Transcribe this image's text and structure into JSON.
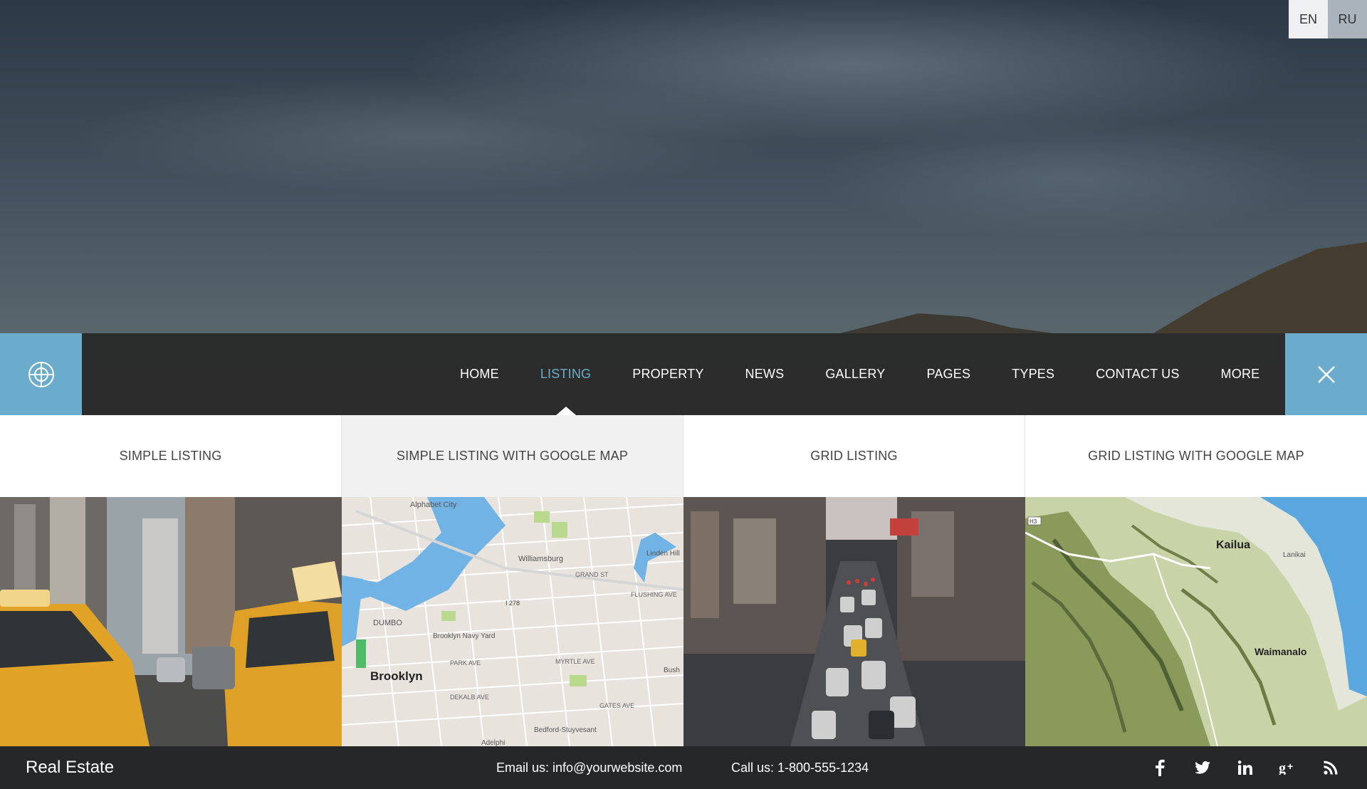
{
  "language": {
    "options": [
      "EN",
      "RU"
    ],
    "active": "EN"
  },
  "nav": {
    "items": [
      "HOME",
      "LISTING",
      "PROPERTY",
      "NEWS",
      "GALLERY",
      "PAGES",
      "TYPES",
      "CONTACT US",
      "MORE"
    ],
    "active": "LISTING",
    "accent_color": "#6baccc"
  },
  "dropdown": {
    "items": [
      {
        "label": "SIMPLE LISTING",
        "image": "taxi-street-photo"
      },
      {
        "label": "SIMPLE LISTING WITH GOOGLE MAP",
        "image": "brooklyn-street-map"
      },
      {
        "label": "GRID LISTING",
        "image": "city-traffic-photo"
      },
      {
        "label": "GRID LISTING WITH GOOGLE MAP",
        "image": "kailua-terrain-map"
      }
    ],
    "highlighted": "SIMPLE LISTING WITH GOOGLE MAP"
  },
  "map_labels": {
    "brooklyn": [
      "Alphabet City",
      "Williamsburg",
      "Linden Hill",
      "DUMBO",
      "Brooklyn Navy Yard",
      "Brooklyn",
      "Bedford-Stuyvesant",
      "Adelphi",
      "I 278",
      "GRAND ST",
      "MYRTLE AVE",
      "PARK AVE",
      "DEKALB AVE",
      "GATES AVE",
      "FLUSHING AVE",
      "Bush"
    ],
    "kailua": [
      "Kailua",
      "Lanikai",
      "Waimanalo",
      "H3"
    ]
  },
  "footer": {
    "brand": "Real Estate",
    "email": "Email us: info@yourwebsite.com",
    "phone": "Call us: 1-800-555-1234",
    "socials": [
      "facebook-icon",
      "twitter-icon",
      "linkedin-icon",
      "google-plus-icon",
      "rss-icon"
    ]
  }
}
